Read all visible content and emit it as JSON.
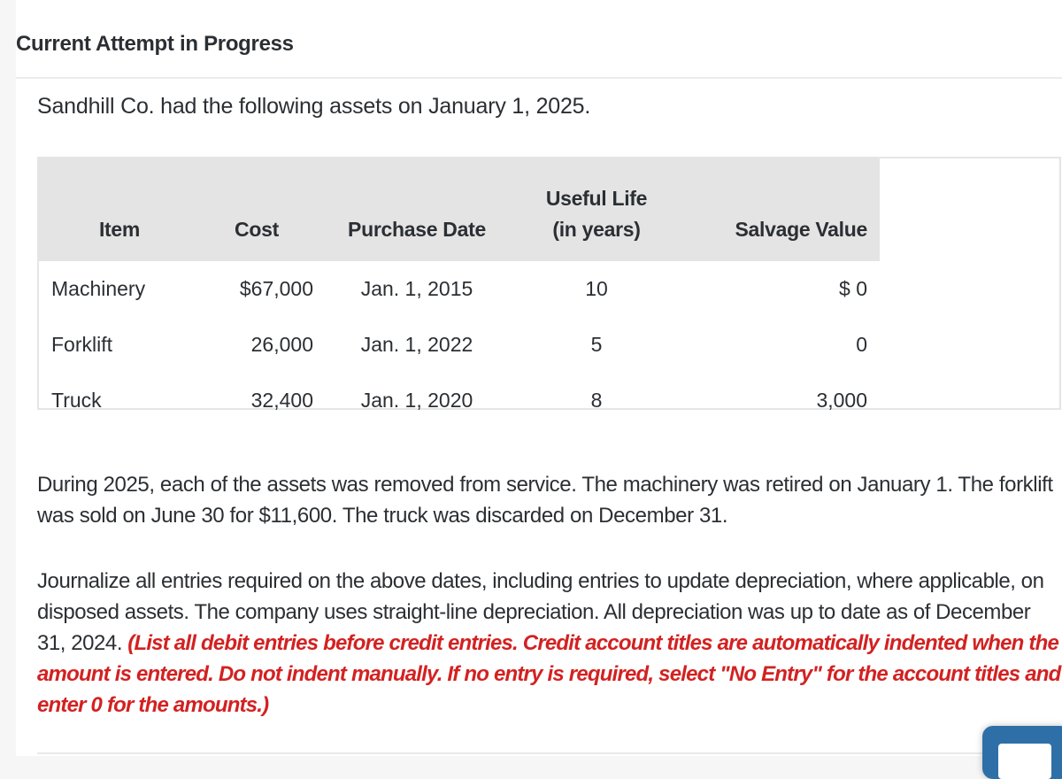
{
  "header": {
    "title": "Current Attempt in Progress"
  },
  "problem": {
    "intro": "Sandhill Co. had the following assets on January 1, 2025.",
    "table": {
      "columns": [
        {
          "key": "item",
          "label": "Item"
        },
        {
          "key": "cost",
          "label": "Cost"
        },
        {
          "key": "purchase_date",
          "label": "Purchase Date"
        },
        {
          "key": "useful_life",
          "label_line1": "Useful Life",
          "label_line2": "(in years)"
        },
        {
          "key": "salvage_value",
          "label": "Salvage Value"
        }
      ],
      "rows": [
        {
          "item": "Machinery",
          "cost": "$67,000",
          "purchase_date": "Jan. 1, 2015",
          "useful_life": "10",
          "salvage_value": "$ 0"
        },
        {
          "item": "Forklift",
          "cost": "26,000",
          "purchase_date": "Jan. 1, 2022",
          "useful_life": "5",
          "salvage_value": "0"
        },
        {
          "item": "Truck",
          "cost": "32,400",
          "purchase_date": "Jan. 1, 2020",
          "useful_life": "8",
          "salvage_value": "3,000"
        }
      ]
    },
    "paragraph1": "During 2025, each of the assets was removed from service. The machinery was retired on January 1. The forklift was sold on June 30 for $11,600. The truck was discarded on December 31.",
    "paragraph2": "Journalize all entries required on the above dates, including entries to update depreciation, where applicable, on disposed assets. The company uses straight-line depreciation. All depreciation was up to date as of December 31, 2024.",
    "instruction_note": "(List all debit entries before credit entries. Credit account titles are automatically indented when the amount is entered. Do not indent manually. If no entry is required, select \"No Entry\" for the account titles and enter 0 for the amounts.)"
  },
  "colors": {
    "note_red": "#d32121",
    "header_gray": "#e4e4e4",
    "button_blue": "#2f6fa8"
  }
}
